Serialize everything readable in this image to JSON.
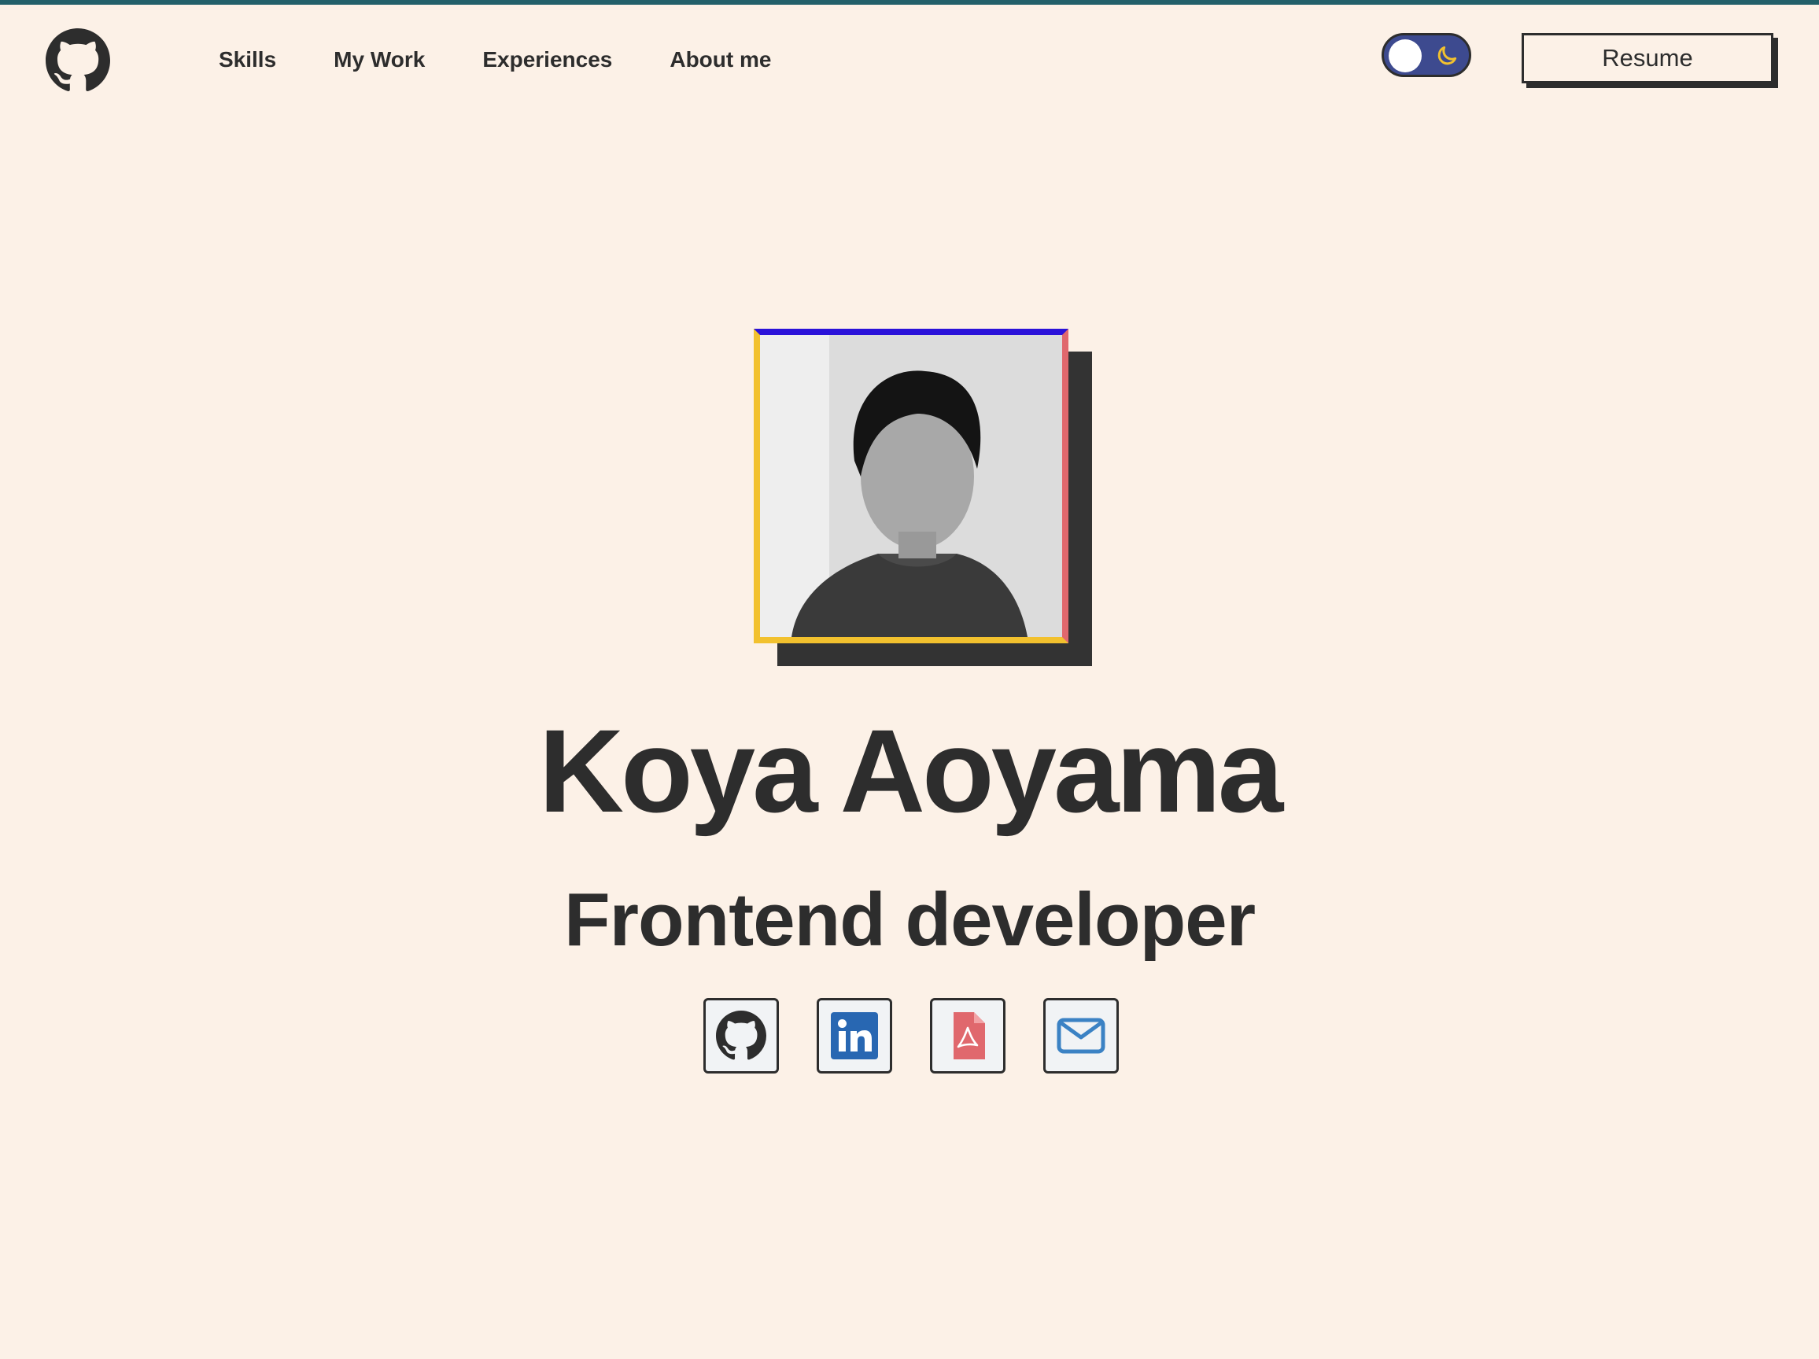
{
  "header": {
    "logo_icon": "github-icon",
    "nav": [
      {
        "label": "Skills"
      },
      {
        "label": "My Work"
      },
      {
        "label": "Experiences"
      },
      {
        "label": "About me"
      }
    ],
    "theme_toggle": {
      "icon": "moon-icon",
      "state": "light"
    },
    "resume_label": "Resume"
  },
  "hero": {
    "photo": "profile-photo",
    "name": "Koya Aoyama",
    "role": "Frontend developer",
    "socials": [
      {
        "icon": "github-icon"
      },
      {
        "icon": "linkedin-icon"
      },
      {
        "icon": "pdf-icon"
      },
      {
        "icon": "mail-icon"
      }
    ]
  },
  "colors": {
    "background": "#fcf1e7",
    "text": "#2d2d2d",
    "top_strip": "#23606a",
    "toggle_bg": "#3d4a8f",
    "moon": "#f2c12e",
    "frame_top": "#2a12d9",
    "frame_left_bottom": "#f2c12e",
    "frame_right": "#e0686d",
    "linkedin": "#2867b2",
    "pdf": "#e0686d",
    "mail": "#3b82c4"
  }
}
